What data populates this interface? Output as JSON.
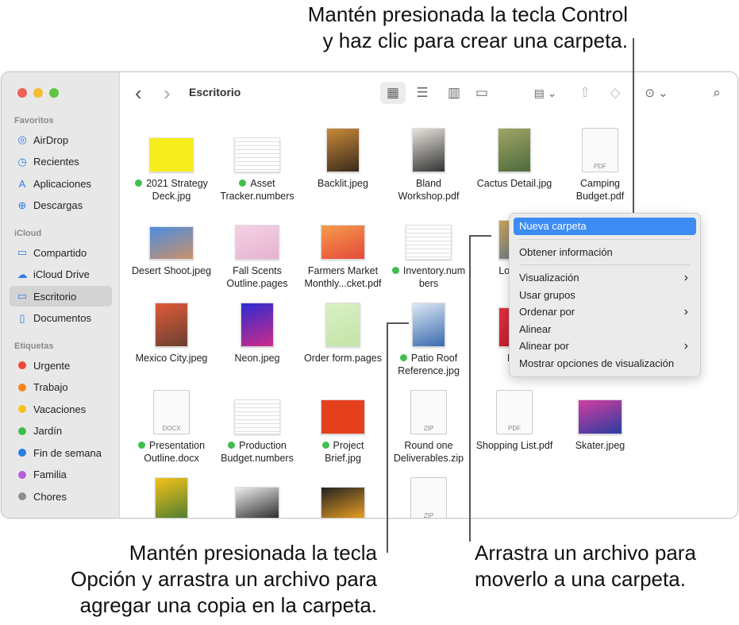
{
  "annotations": {
    "top": [
      "Mantén presionada la tecla Control",
      "y haz clic para crear una carpeta."
    ],
    "bottom_left": [
      "Mantén presionada la tecla",
      "Opción y arrastra un archivo para",
      "agregar una copia en la carpeta."
    ],
    "bottom_right": [
      "Arrastra un archivo para",
      "moverlo a una carpeta."
    ]
  },
  "window": {
    "title": "Escritorio"
  },
  "toolbar": {
    "back": "‹",
    "forward": "›",
    "icons": [
      "icon-view-icon",
      "list-view-icon",
      "column-view-icon",
      "gallery-view-icon",
      "group-icon",
      "share-icon",
      "tag-icon",
      "more-icon",
      "search-icon"
    ]
  },
  "sidebar": {
    "sections": [
      {
        "header": "Favoritos",
        "items": [
          {
            "label": "AirDrop",
            "icon": "airdrop-icon"
          },
          {
            "label": "Recientes",
            "icon": "clock-icon"
          },
          {
            "label": "Aplicaciones",
            "icon": "applications-icon"
          },
          {
            "label": "Descargas",
            "icon": "downloads-icon"
          }
        ]
      },
      {
        "header": "iCloud",
        "items": [
          {
            "label": "Compartido",
            "icon": "shared-folder-icon"
          },
          {
            "label": "iCloud Drive",
            "icon": "cloud-icon"
          },
          {
            "label": "Escritorio",
            "icon": "desktop-icon",
            "selected": true
          },
          {
            "label": "Documentos",
            "icon": "document-icon"
          }
        ]
      },
      {
        "header": "Etiquetas",
        "items": [
          {
            "label": "Urgente",
            "color": "#f0453a"
          },
          {
            "label": "Trabajo",
            "color": "#f7841b"
          },
          {
            "label": "Vacaciones",
            "color": "#f5c21b"
          },
          {
            "label": "Jardín",
            "color": "#3cbf4a"
          },
          {
            "label": "Fin de semana",
            "color": "#2a7de1"
          },
          {
            "label": "Familia",
            "color": "#b25fd8"
          },
          {
            "label": "Chores",
            "color": "#8e8e8e"
          }
        ]
      }
    ]
  },
  "files": [
    {
      "lines": [
        "2021 Strategy",
        "Deck.jpg"
      ],
      "dot": true,
      "kind": "img",
      "colors": [
        "#f6ee1c",
        "#f6ee1c"
      ],
      "w": 56,
      "h": 44
    },
    {
      "lines": [
        "Asset",
        "Tracker.numbers"
      ],
      "dot": true,
      "kind": "sheet"
    },
    {
      "lines": [
        "Backlit.jpeg"
      ],
      "kind": "img",
      "colors": [
        "#c98a3a",
        "#3a2a1a"
      ],
      "w": 42,
      "h": 56
    },
    {
      "lines": [
        "Bland",
        "Workshop.pdf"
      ],
      "kind": "img",
      "colors": [
        "#e8e4dc",
        "#333"
      ],
      "w": 42,
      "h": 56
    },
    {
      "lines": [
        "Cactus Detail.jpg"
      ],
      "kind": "img",
      "colors": [
        "#9fa565",
        "#4e6a3c"
      ],
      "w": 42,
      "h": 56
    },
    {
      "lines": [
        "Camping",
        "Budget.pdf"
      ],
      "kind": "doc",
      "ext": "PDF"
    },
    {
      "lines": [
        "Desert Shoot.jpeg"
      ],
      "kind": "img",
      "colors": [
        "#4d8ee0",
        "#c9906a"
      ],
      "w": 56,
      "h": 42
    },
    {
      "lines": [
        "Fall Scents",
        "Outline.pages"
      ],
      "kind": "img",
      "colors": [
        "#f4d2e4",
        "#e6b2d0"
      ],
      "w": 56,
      "h": 44
    },
    {
      "lines": [
        "Farmers Market",
        "Monthly...cket.pdf"
      ],
      "kind": "img",
      "colors": [
        "#f59b4a",
        "#e5493a"
      ],
      "w": 56,
      "h": 44
    },
    {
      "lines": [
        "Inventory.num",
        "bers"
      ],
      "dot": true,
      "kind": "sheet"
    },
    {
      "lines": [
        "Lone P"
      ],
      "kind": "img",
      "colors": [
        "#c9a25a",
        "#6a7c8a"
      ],
      "w": 40,
      "h": 50
    },
    null,
    {
      "lines": [
        "Mexico City.jpeg"
      ],
      "kind": "img",
      "colors": [
        "#e05a3a",
        "#6a4030"
      ],
      "w": 42,
      "h": 56
    },
    {
      "lines": [
        "Neon.jpeg"
      ],
      "kind": "img",
      "colors": [
        "#2b2bd0",
        "#d02b8a"
      ],
      "w": 42,
      "h": 56
    },
    {
      "lines": [
        "Order form.pages"
      ],
      "kind": "img",
      "colors": [
        "#d9f0c4",
        "#c3e4a8"
      ],
      "w": 44,
      "h": 56
    },
    {
      "lines": [
        "Patio Roof",
        "Reference.jpg"
      ],
      "dot": true,
      "kind": "img",
      "colors": [
        "#dce8f4",
        "#3a6ab0"
      ],
      "w": 42,
      "h": 56
    },
    {
      "lines": [
        "Pin"
      ],
      "kind": "img",
      "colors": [
        "#e2303e",
        "#c01c2c"
      ],
      "w": 40,
      "h": 50
    },
    null,
    {
      "lines": [
        "Presentation",
        "Outline.docx"
      ],
      "dot": true,
      "kind": "doc",
      "ext": "DOCX"
    },
    {
      "lines": [
        "Production",
        "Budget.numbers"
      ],
      "dot": true,
      "kind": "sheet"
    },
    {
      "lines": [
        "Project",
        "Brief.jpg"
      ],
      "dot": true,
      "kind": "img",
      "colors": [
        "#e5401e",
        "#e5401e"
      ],
      "w": 56,
      "h": 44
    },
    {
      "lines": [
        "Round one",
        "Deliverables.zip"
      ],
      "kind": "doc",
      "ext": "ZIP"
    },
    {
      "lines": [
        "Shopping List.pdf"
      ],
      "kind": "doc",
      "ext": "PDF"
    },
    {
      "lines": [
        "Skater.jpeg"
      ],
      "kind": "img",
      "colors": [
        "#d23fa0",
        "#2a3ca0"
      ],
      "w": 56,
      "h": 44
    },
    {
      "lines": [],
      "kind": "img",
      "colors": [
        "#f3c21a",
        "#4a7a30"
      ],
      "w": 42,
      "h": 56
    },
    {
      "lines": [],
      "kind": "img",
      "colors": [
        "#eee",
        "#222"
      ],
      "w": 56,
      "h": 44
    },
    {
      "lines": [],
      "kind": "img",
      "colors": [
        "#222",
        "#f5a623"
      ],
      "w": 56,
      "h": 44
    },
    {
      "lines": [],
      "kind": "doc",
      "ext": "ZIP"
    }
  ],
  "context_menu": {
    "items": [
      {
        "label": "Nueva carpeta",
        "highlighted": true
      },
      {
        "sep": true
      },
      {
        "label": "Obtener información"
      },
      {
        "sep": true
      },
      {
        "label": "Visualización",
        "submenu": true
      },
      {
        "label": "Usar grupos"
      },
      {
        "label": "Ordenar por",
        "submenu": true
      },
      {
        "label": "Alinear"
      },
      {
        "label": "Alinear por",
        "submenu": true
      },
      {
        "label": "Mostrar opciones de visualización"
      }
    ]
  }
}
